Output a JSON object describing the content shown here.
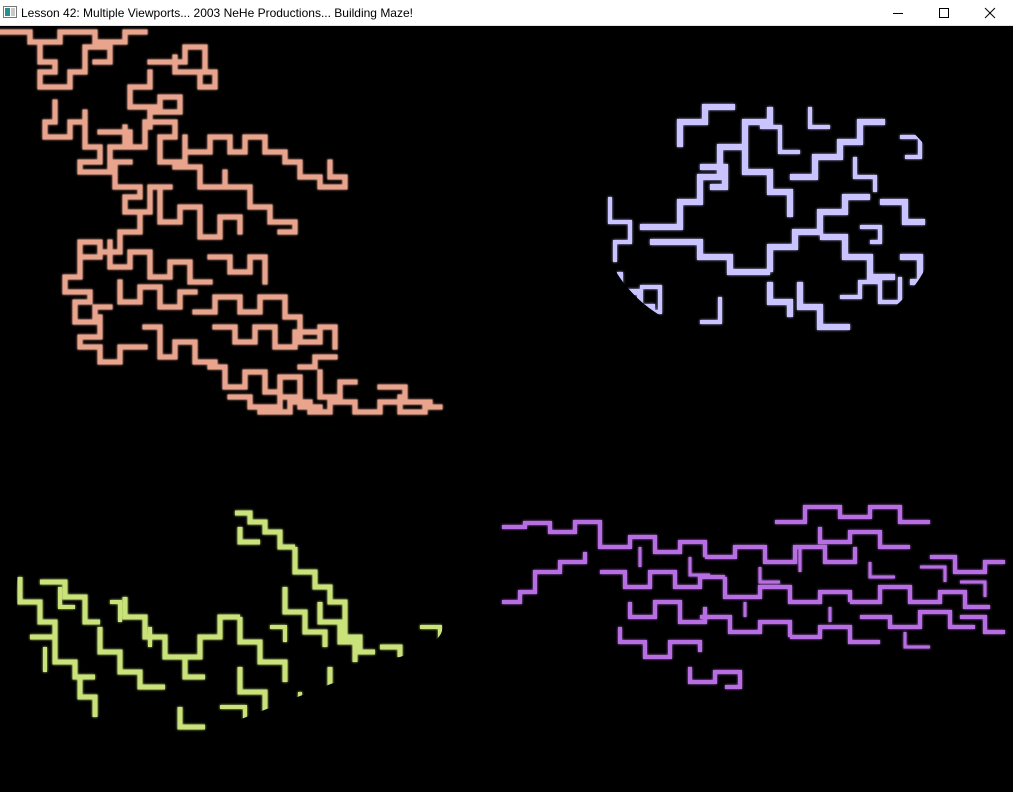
{
  "window": {
    "title": "Lesson 42: Multiple Viewports... 2003 NeHe Productions... Building Maze!",
    "icon": "app-window-icon",
    "controls": {
      "minimize_icon": "minimize-icon",
      "maximize_icon": "maximize-icon",
      "close_icon": "close-icon"
    }
  },
  "viewports": [
    {
      "name": "top-left",
      "shape": "flat-maze-2d",
      "color": "#e9a48e",
      "glow": "#f7d2c4"
    },
    {
      "name": "top-right",
      "shape": "sphere-maze",
      "color": "#c9c4ff",
      "glow": "#ffffff"
    },
    {
      "name": "bottom-left",
      "shape": "cylinder-maze",
      "color": "#c9e27a",
      "glow": "#f2ffc9"
    },
    {
      "name": "bottom-right",
      "shape": "perspective-plane-maze",
      "color": "#b86ee3",
      "glow": "#e7c9ff"
    }
  ]
}
